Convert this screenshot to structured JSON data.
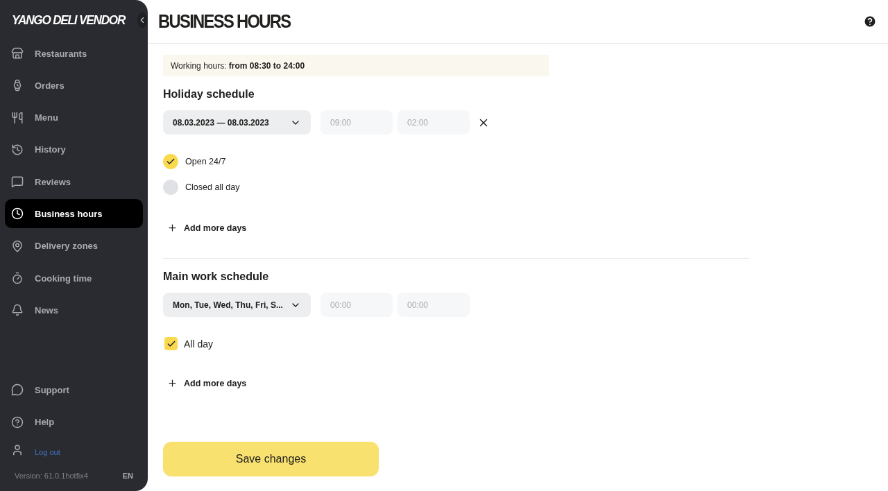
{
  "sidebar": {
    "logo": "YANGO DELI VENDOR",
    "items": [
      {
        "label": "Restaurants",
        "selected": false
      },
      {
        "label": "Orders",
        "selected": false
      },
      {
        "label": "Menu",
        "selected": false
      },
      {
        "label": "History",
        "selected": false
      },
      {
        "label": "Reviews",
        "selected": false
      },
      {
        "label": "Business hours",
        "selected": true
      },
      {
        "label": "Delivery zones",
        "selected": false
      },
      {
        "label": "Cooking time",
        "selected": false
      },
      {
        "label": "News",
        "selected": false
      }
    ],
    "bottom_items": [
      {
        "label": "Support"
      },
      {
        "label": "Help"
      }
    ],
    "logout": "Log out",
    "version": "Version: 61.0.1hotfix4",
    "language": "EN"
  },
  "page": {
    "title": "BUSINESS HOURS"
  },
  "working_hours": "Working hours: **from 08:30 to 24:00**",
  "holiday_schedule": {
    "title": "Holiday schedule",
    "date_range": "08.03.2023 — 08.03.2023",
    "time_from": {
      "value": "09:00",
      "disabled": true
    },
    "time_to": {
      "value": "02:00",
      "disabled": true
    },
    "options": [
      {
        "label": "Open 24/7",
        "selected": true
      },
      {
        "label": "Closed all day",
        "selected": false
      }
    ],
    "add_button": "Add more days"
  },
  "main_schedule": {
    "title": "Main work schedule",
    "days": "Mon, Tue, Wed, Thu, Fri, S...",
    "time_from": {
      "value": "00:00",
      "disabled": true
    },
    "time_to": {
      "value": "00:00",
      "disabled": true
    },
    "all_day": {
      "label": "All day",
      "checked": true
    },
    "add_button": "Add more days"
  },
  "save_button": "Save changes"
}
